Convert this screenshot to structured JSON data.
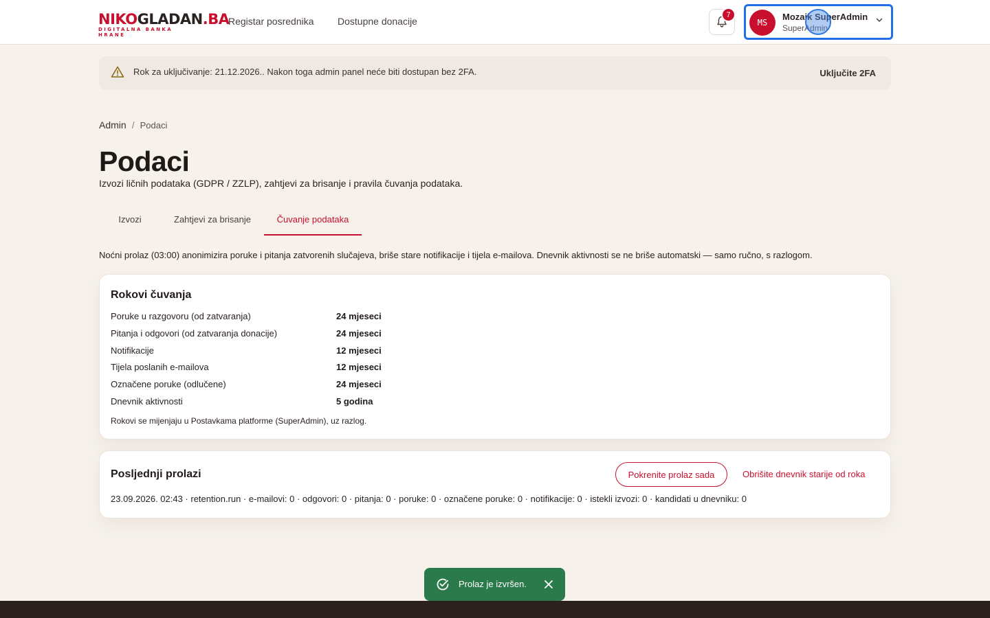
{
  "brand": {
    "logo_red": "NIKO",
    "logo_dark": "GLADAN",
    "logo_suffix": ".BA",
    "tagline": "DIGITALNA BANKA HRANE",
    "accent": "#c8102e"
  },
  "nav": {
    "links": [
      "Registar posrednika",
      "Dostupne donacije"
    ]
  },
  "notifications": {
    "count": "7",
    "icon": "bell-icon"
  },
  "user": {
    "initials": "MS",
    "name": "Mozaik SuperAdmin",
    "role": "SuperAdmin"
  },
  "alert": {
    "text": "Rok za uključivanje: 21.12.2026.. Nakon toga admin panel neće biti dostupan bez 2FA.",
    "action": "Uključite 2FA",
    "icon": "warning-icon"
  },
  "breadcrumb": {
    "root": "Admin",
    "separator": "/",
    "current": "Podaci"
  },
  "page": {
    "title": "Podaci",
    "subtitle": "Izvozi ličnih podataka (GDPR / ZZLP), zahtjevi za brisanje i pravila čuvanja podataka."
  },
  "tabs": [
    {
      "label": "Izvozi",
      "active": false
    },
    {
      "label": "Zahtjevi za brisanje",
      "active": false
    },
    {
      "label": "Čuvanje podataka",
      "active": true
    }
  ],
  "intro": "Noćni prolaz (03:00) anonimizira poruke i pitanja zatvorenih slučajeva, briše stare notifikacije i tijela e-mailova. Dnevnik aktivnosti se ne briše automatski — samo ručno, s razlogom.",
  "retention": {
    "title": "Rokovi čuvanja",
    "rows": [
      {
        "label": "Poruke u razgovoru (od zatvaranja)",
        "value": "24 mjeseci"
      },
      {
        "label": "Pitanja i odgovori (od zatvaranja donacije)",
        "value": "24 mjeseci"
      },
      {
        "label": "Notifikacije",
        "value": "12 mjeseci"
      },
      {
        "label": "Tijela poslanih e-mailova",
        "value": "12 mjeseci"
      },
      {
        "label": "Označene poruke (odlučene)",
        "value": "24 mjeseci"
      },
      {
        "label": "Dnevnik aktivnosti",
        "value": "5 godina"
      }
    ],
    "note": "Rokovi se mijenjaju u Postavkama platforme (SuperAdmin), uz razlog."
  },
  "runs": {
    "title": "Posljednji prolazi",
    "run_button": "Pokrenite prolaz sada",
    "purge_link": "Obrišite dnevnik starije od roka",
    "entries": [
      "23.09.2026. 02:43 · retention.run · e-mailovi: 0 · odgovori: 0 · pitanja: 0 · poruke: 0 · označene poruke: 0 · notifikacije: 0 · istekli izvozi: 0 · kandidati u dnevniku: 0"
    ]
  },
  "toast": {
    "text": "Prolaz je izvršen.",
    "icon": "check-circle-icon",
    "close_icon": "close-icon",
    "color": "#2b7a4b"
  }
}
